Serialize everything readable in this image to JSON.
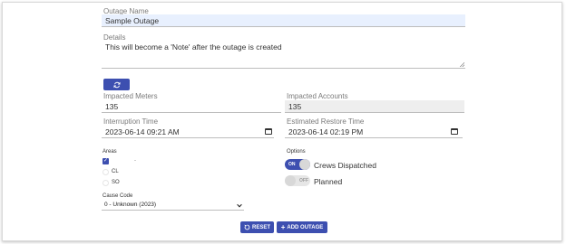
{
  "outage_name": {
    "label": "Outage Name",
    "value": "Sample Outage"
  },
  "details": {
    "label": "Details",
    "value": "This will become a 'Note' after the outage is created"
  },
  "refresh_icon": "refresh-icon",
  "impacted_meters": {
    "label": "Impacted Meters",
    "value": "135"
  },
  "impacted_accounts": {
    "label": "Impacted Accounts",
    "value": "135"
  },
  "interruption_time": {
    "label": "Interruption Time",
    "value": "2023-06-14 09:21 AM"
  },
  "estimated_restore_time": {
    "label": "Estimated Restore Time",
    "value": "2023-06-14 02:19 PM"
  },
  "areas": {
    "label": "Areas",
    "items": [
      {
        "label": "",
        "checked": true
      },
      {
        "label": "CL",
        "checked": false
      },
      {
        "label": "SO",
        "checked": false
      }
    ]
  },
  "options": {
    "label": "Options",
    "crews_dispatched": {
      "label": "Crews Dispatched",
      "state": "ON",
      "on": true
    },
    "planned": {
      "label": "Planned",
      "state": "OFF",
      "on": false
    }
  },
  "cause_code": {
    "label": "Cause Code",
    "selected": "0 - Unknown (2023)"
  },
  "buttons": {
    "reset": "RESET",
    "add_outage": "ADD OUTAGE"
  },
  "colors": {
    "primary": "#3d4fb0",
    "autofill": "#e8f0fe",
    "readonly": "#eeeeee"
  }
}
